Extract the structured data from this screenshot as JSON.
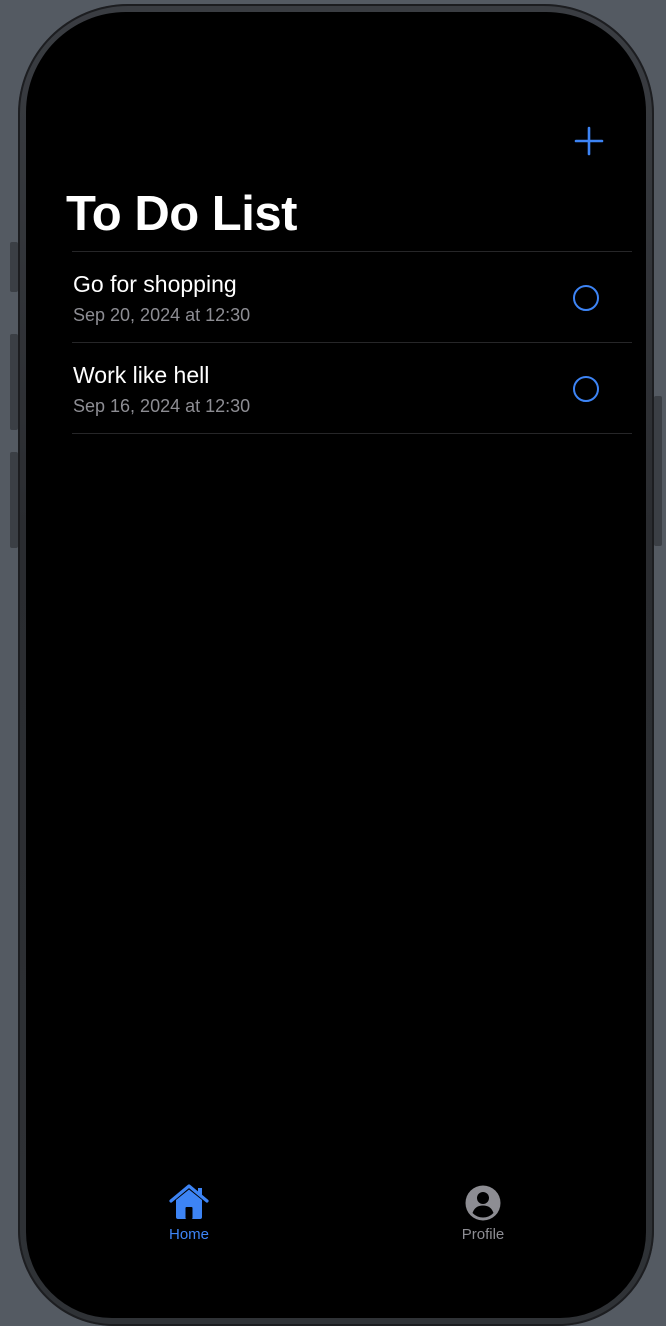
{
  "app": {
    "title": "To Do List",
    "accent_color": "#3d84f5"
  },
  "toolbar": {
    "add_icon": "plus-icon"
  },
  "items": [
    {
      "title": "Go for shopping",
      "date": "Sep 20, 2024 at 12:30",
      "done": false
    },
    {
      "title": "Work like hell",
      "date": "Sep 16, 2024 at 12:30",
      "done": false
    }
  ],
  "tabs": [
    {
      "label": "Home",
      "icon": "house-icon",
      "active": true,
      "color": "#3d84f5"
    },
    {
      "label": "Profile",
      "icon": "person-circle-icon",
      "active": false,
      "color": "#8d8d93"
    }
  ]
}
